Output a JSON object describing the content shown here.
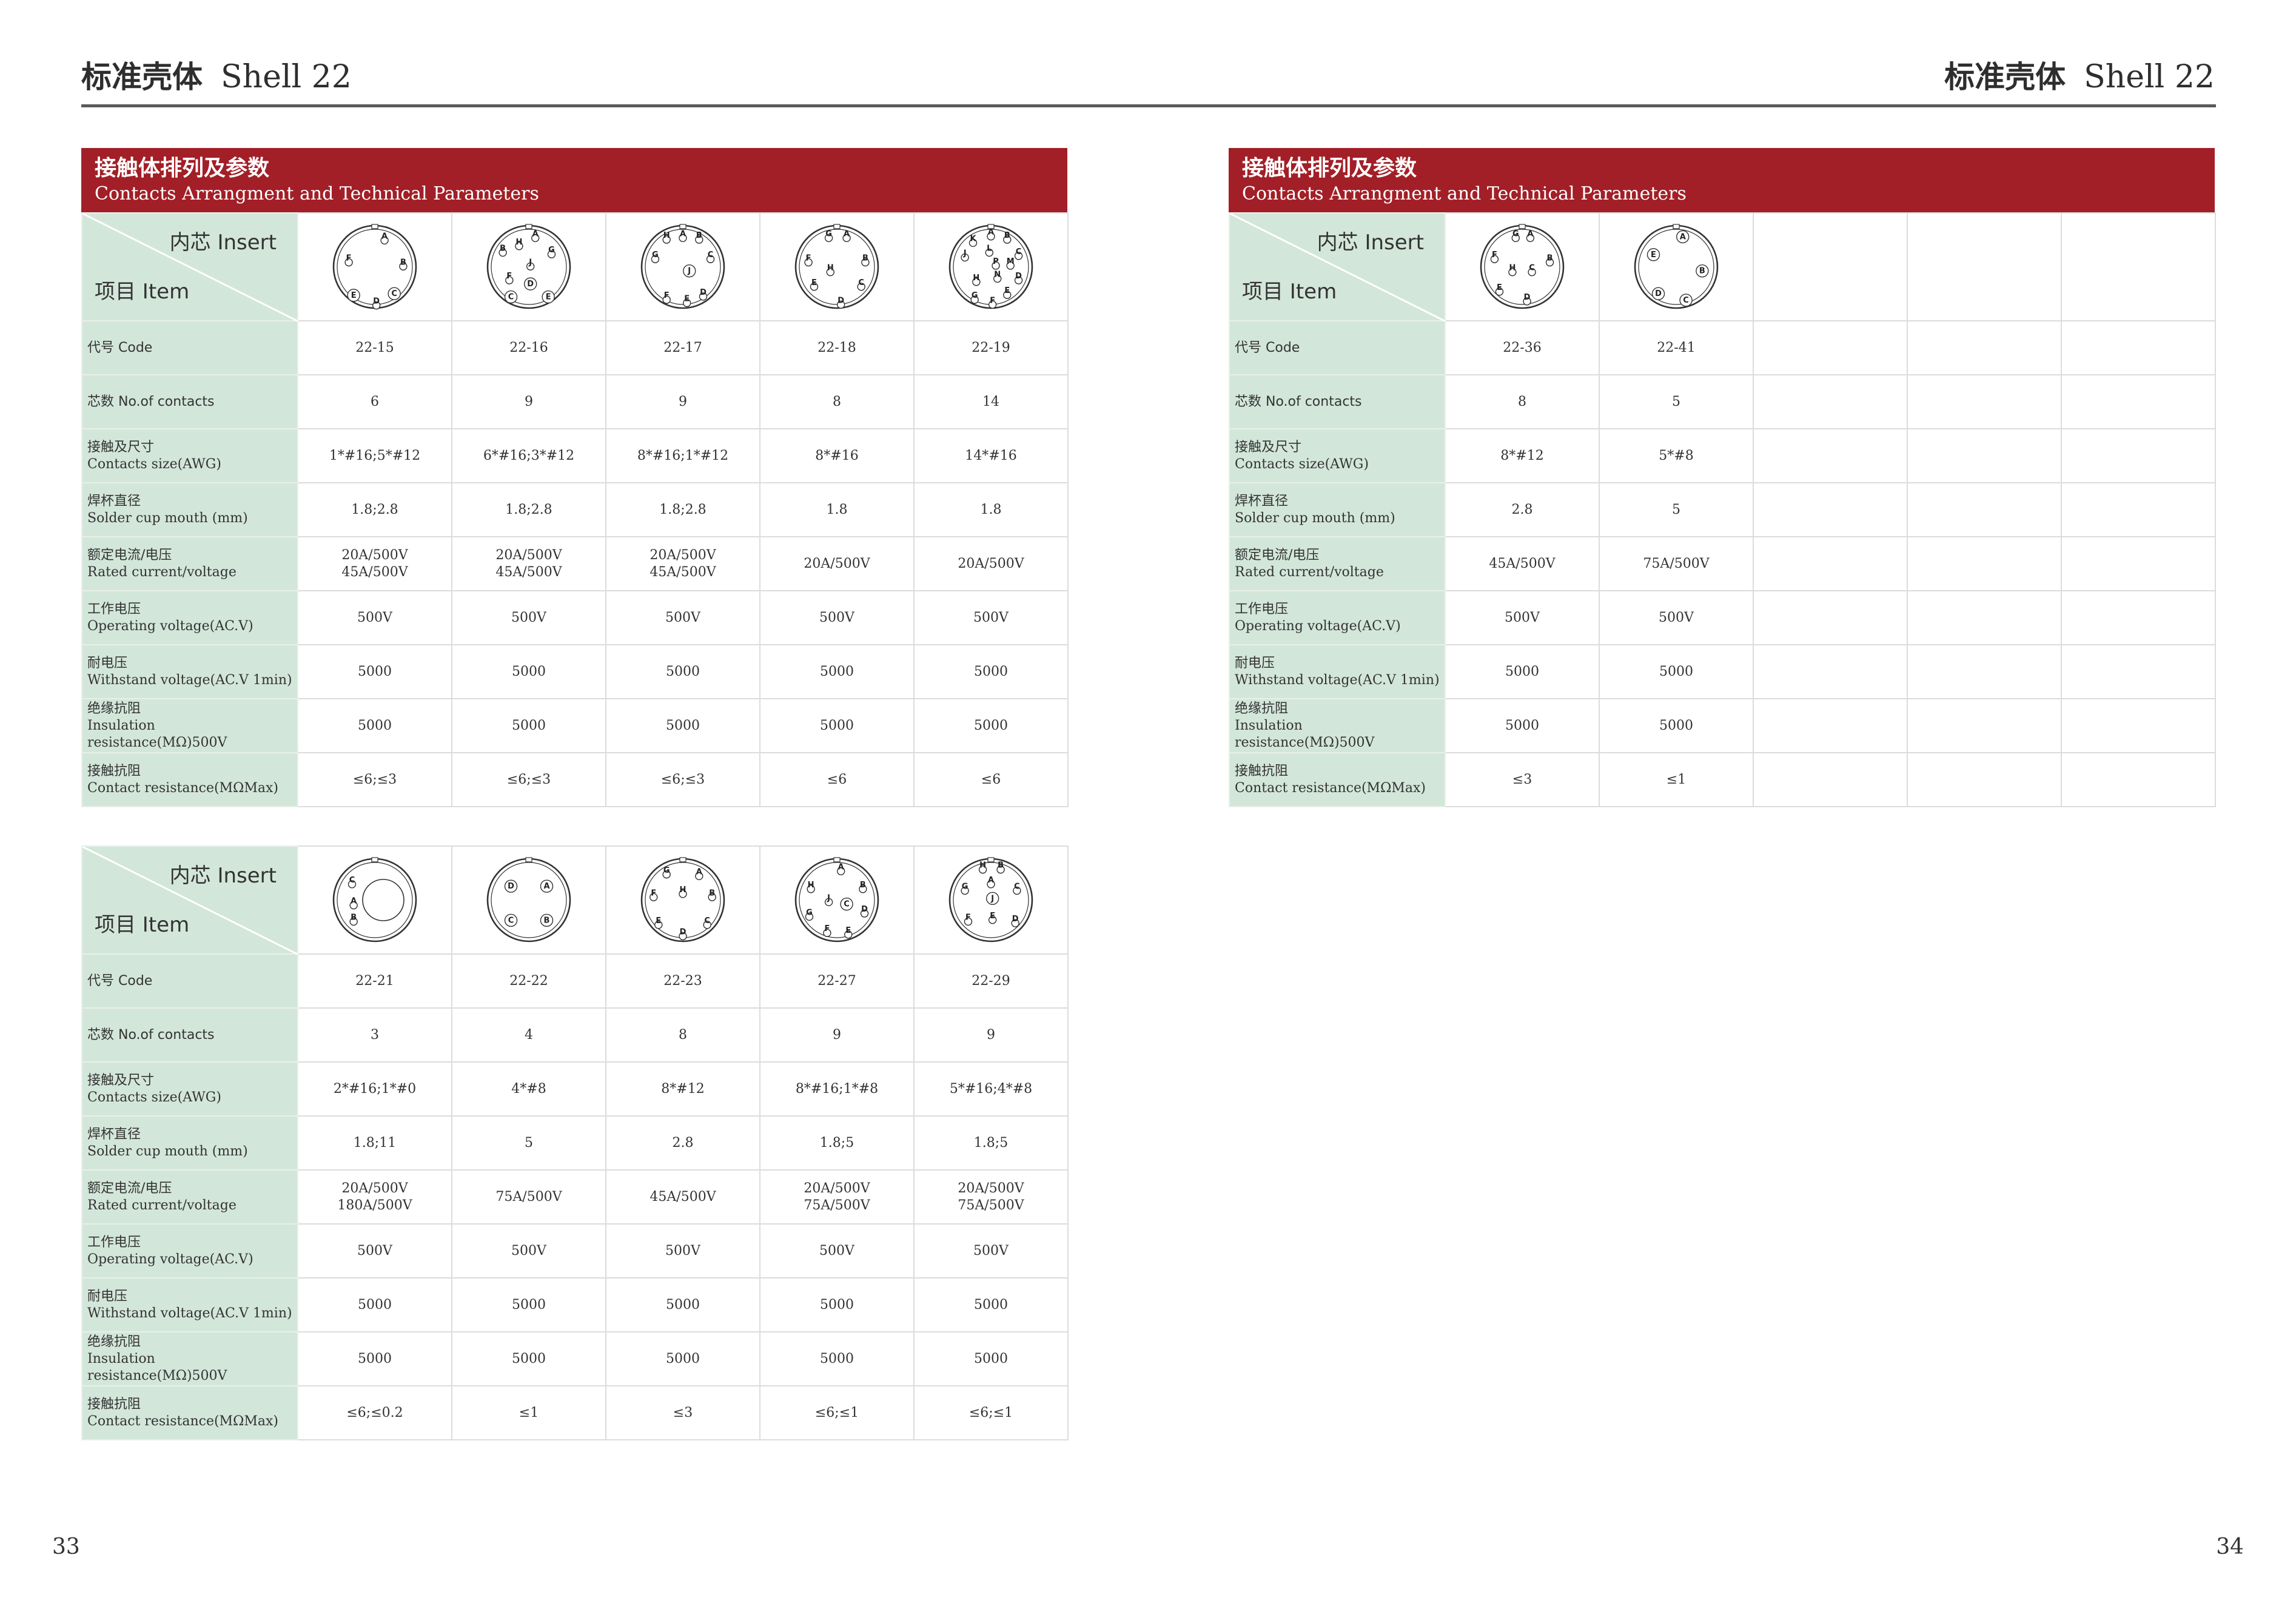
{
  "header": {
    "title_cn": "标准壳体",
    "title_en": "Shell 22"
  },
  "page_numbers": {
    "left": "33",
    "right": "34"
  },
  "banner": {
    "cn": "接触体排列及参数",
    "en": "Contacts Arrangment and Technical Parameters"
  },
  "corner": {
    "insert": "内芯 Insert",
    "item": "项目 Item"
  },
  "row_labels": [
    {
      "cn": "代号 Code",
      "en": ""
    },
    {
      "cn": "芯数 No.of contacts",
      "en": ""
    },
    {
      "cn": "接触及尺寸",
      "en": "Contacts size(AWG)"
    },
    {
      "cn": "焊杯直径",
      "en": "Solder cup mouth (mm)"
    },
    {
      "cn": "额定电流/电压",
      "en": "Rated current/voltage"
    },
    {
      "cn": "工作电压",
      "en": "Operating voltage(AC.V)"
    },
    {
      "cn": "耐电压",
      "en": "Withstand voltage(AC.V 1min)"
    },
    {
      "cn": "绝缘抗阻",
      "en": "Insulation resistance(MΩ)500V"
    },
    {
      "cn": "接触抗阻",
      "en": "Contact resistance(MΩMax)"
    }
  ],
  "tables": [
    {
      "id": "table-a",
      "columns": [
        {
          "code": "22-15",
          "contacts": "6",
          "size": "1*#16;5*#12",
          "cup": "1.8;2.8",
          "rated": [
            "20A/500V",
            "45A/500V"
          ],
          "op": "500V",
          "withstand": "5000",
          "insulation": "5000",
          "contact_res": "≤6;≤3",
          "pins": [
            {
              "t": "A"
            },
            {
              "t": "F"
            },
            {
              "t": "B"
            },
            {
              "t": "E"
            },
            {
              "t": "C"
            },
            {
              "t": "D"
            }
          ]
        },
        {
          "code": "22-16",
          "contacts": "9",
          "size": "6*#16;3*#12",
          "cup": "1.8;2.8",
          "rated": [
            "20A/500V",
            "45A/500V"
          ],
          "op": "500V",
          "withstand": "5000",
          "insulation": "5000",
          "contact_res": "≤6;≤3",
          "pins": [
            {
              "t": "A"
            },
            {
              "t": "B"
            },
            {
              "t": "H"
            },
            {
              "t": "G"
            },
            {
              "t": "J"
            },
            {
              "t": "F"
            },
            {
              "t": "C"
            },
            {
              "t": "D"
            },
            {
              "t": "E"
            }
          ]
        },
        {
          "code": "22-17",
          "contacts": "9",
          "size": "8*#16;1*#12",
          "cup": "1.8;2.8",
          "rated": [
            "20A/500V",
            "45A/500V"
          ],
          "op": "500V",
          "withstand": "5000",
          "insulation": "5000",
          "contact_res": "≤6;≤3",
          "pins": [
            {
              "t": "H"
            },
            {
              "t": "A"
            },
            {
              "t": "B"
            },
            {
              "t": "G"
            },
            {
              "t": "C"
            },
            {
              "t": "J"
            },
            {
              "t": "F"
            },
            {
              "t": "E"
            },
            {
              "t": "D"
            }
          ]
        },
        {
          "code": "22-18",
          "contacts": "8",
          "size": "8*#16",
          "cup": "1.8",
          "rated": [
            "20A/500V"
          ],
          "op": "500V",
          "withstand": "5000",
          "insulation": "5000",
          "contact_res": "≤6",
          "pins": [
            {
              "t": "G"
            },
            {
              "t": "A"
            },
            {
              "t": "F"
            },
            {
              "t": "B"
            },
            {
              "t": "H"
            },
            {
              "t": "E"
            },
            {
              "t": "C"
            },
            {
              "t": "D"
            }
          ]
        },
        {
          "code": "22-19",
          "contacts": "14",
          "size": "14*#16",
          "cup": "1.8",
          "rated": [
            "20A/500V"
          ],
          "op": "500V",
          "withstand": "5000",
          "insulation": "5000",
          "contact_res": "≤6",
          "pins": [
            {
              "t": "K"
            },
            {
              "t": "A"
            },
            {
              "t": "B"
            },
            {
              "t": "L"
            },
            {
              "t": "C"
            },
            {
              "t": "J"
            },
            {
              "t": "P"
            },
            {
              "t": "M"
            },
            {
              "t": "N"
            },
            {
              "t": "D"
            },
            {
              "t": "H"
            },
            {
              "t": "E"
            },
            {
              "t": "G"
            },
            {
              "t": "F"
            }
          ]
        }
      ]
    },
    {
      "id": "table-b",
      "columns": [
        {
          "code": "22-21",
          "contacts": "3",
          "size": "2*#16;1*#0",
          "cup": "1.8;11",
          "rated": [
            "20A/500V",
            "180A/500V"
          ],
          "op": "500V",
          "withstand": "5000",
          "insulation": "5000",
          "contact_res": "≤6;≤0.2",
          "pins": [
            {
              "t": "C"
            },
            {
              "t": "A"
            },
            {
              "t": "B"
            }
          ]
        },
        {
          "code": "22-22",
          "contacts": "4",
          "size": "4*#8",
          "cup": "5",
          "rated": [
            "75A/500V"
          ],
          "op": "500V",
          "withstand": "5000",
          "insulation": "5000",
          "contact_res": "≤1",
          "pins": [
            {
              "t": "D"
            },
            {
              "t": "A"
            },
            {
              "t": "C"
            },
            {
              "t": "B"
            }
          ]
        },
        {
          "code": "22-23",
          "contacts": "8",
          "size": "8*#12",
          "cup": "2.8",
          "rated": [
            "45A/500V"
          ],
          "op": "500V",
          "withstand": "5000",
          "insulation": "5000",
          "contact_res": "≤3",
          "pins": [
            {
              "t": "G"
            },
            {
              "t": "A"
            },
            {
              "t": "F"
            },
            {
              "t": "H"
            },
            {
              "t": "B"
            },
            {
              "t": "E"
            },
            {
              "t": "C"
            },
            {
              "t": "D"
            }
          ]
        },
        {
          "code": "22-27",
          "contacts": "9",
          "size": "8*#16;1*#8",
          "cup": "1.8;5",
          "rated": [
            "20A/500V",
            "75A/500V"
          ],
          "op": "500V",
          "withstand": "5000",
          "insulation": "5000",
          "contact_res": "≤6;≤1",
          "pins": [
            {
              "t": "A"
            },
            {
              "t": "H"
            },
            {
              "t": "B"
            },
            {
              "t": "J"
            },
            {
              "t": "C"
            },
            {
              "t": "G"
            },
            {
              "t": "D"
            },
            {
              "t": "F"
            },
            {
              "t": "E"
            }
          ]
        },
        {
          "code": "22-29",
          "contacts": "9",
          "size": "5*#16;4*#8",
          "cup": "1.8;5",
          "rated": [
            "20A/500V",
            "75A/500V"
          ],
          "op": "500V",
          "withstand": "5000",
          "insulation": "5000",
          "contact_res": "≤6;≤1",
          "pins": [
            {
              "t": "H"
            },
            {
              "t": "B"
            },
            {
              "t": "G"
            },
            {
              "t": "A"
            },
            {
              "t": "J"
            },
            {
              "t": "C"
            },
            {
              "t": "F"
            },
            {
              "t": "E"
            },
            {
              "t": "D"
            }
          ]
        }
      ]
    },
    {
      "id": "table-c",
      "columns": [
        {
          "code": "22-36",
          "contacts": "8",
          "size": "8*#12",
          "cup": "2.8",
          "rated": [
            "45A/500V"
          ],
          "op": "500V",
          "withstand": "5000",
          "insulation": "5000",
          "contact_res": "≤3",
          "pins": [
            {
              "t": "G"
            },
            {
              "t": "A"
            },
            {
              "t": "F"
            },
            {
              "t": "B"
            },
            {
              "t": "H"
            },
            {
              "t": "C"
            },
            {
              "t": "E"
            },
            {
              "t": "D"
            }
          ]
        },
        {
          "code": "22-41",
          "contacts": "5",
          "size": "5*#8",
          "cup": "5",
          "rated": [
            "75A/500V"
          ],
          "op": "500V",
          "withstand": "5000",
          "insulation": "5000",
          "contact_res": "≤1",
          "pins": [
            {
              "t": "A"
            },
            {
              "t": "E"
            },
            {
              "t": "B"
            },
            {
              "t": "D"
            },
            {
              "t": "C"
            }
          ]
        },
        null,
        null,
        null
      ]
    }
  ]
}
